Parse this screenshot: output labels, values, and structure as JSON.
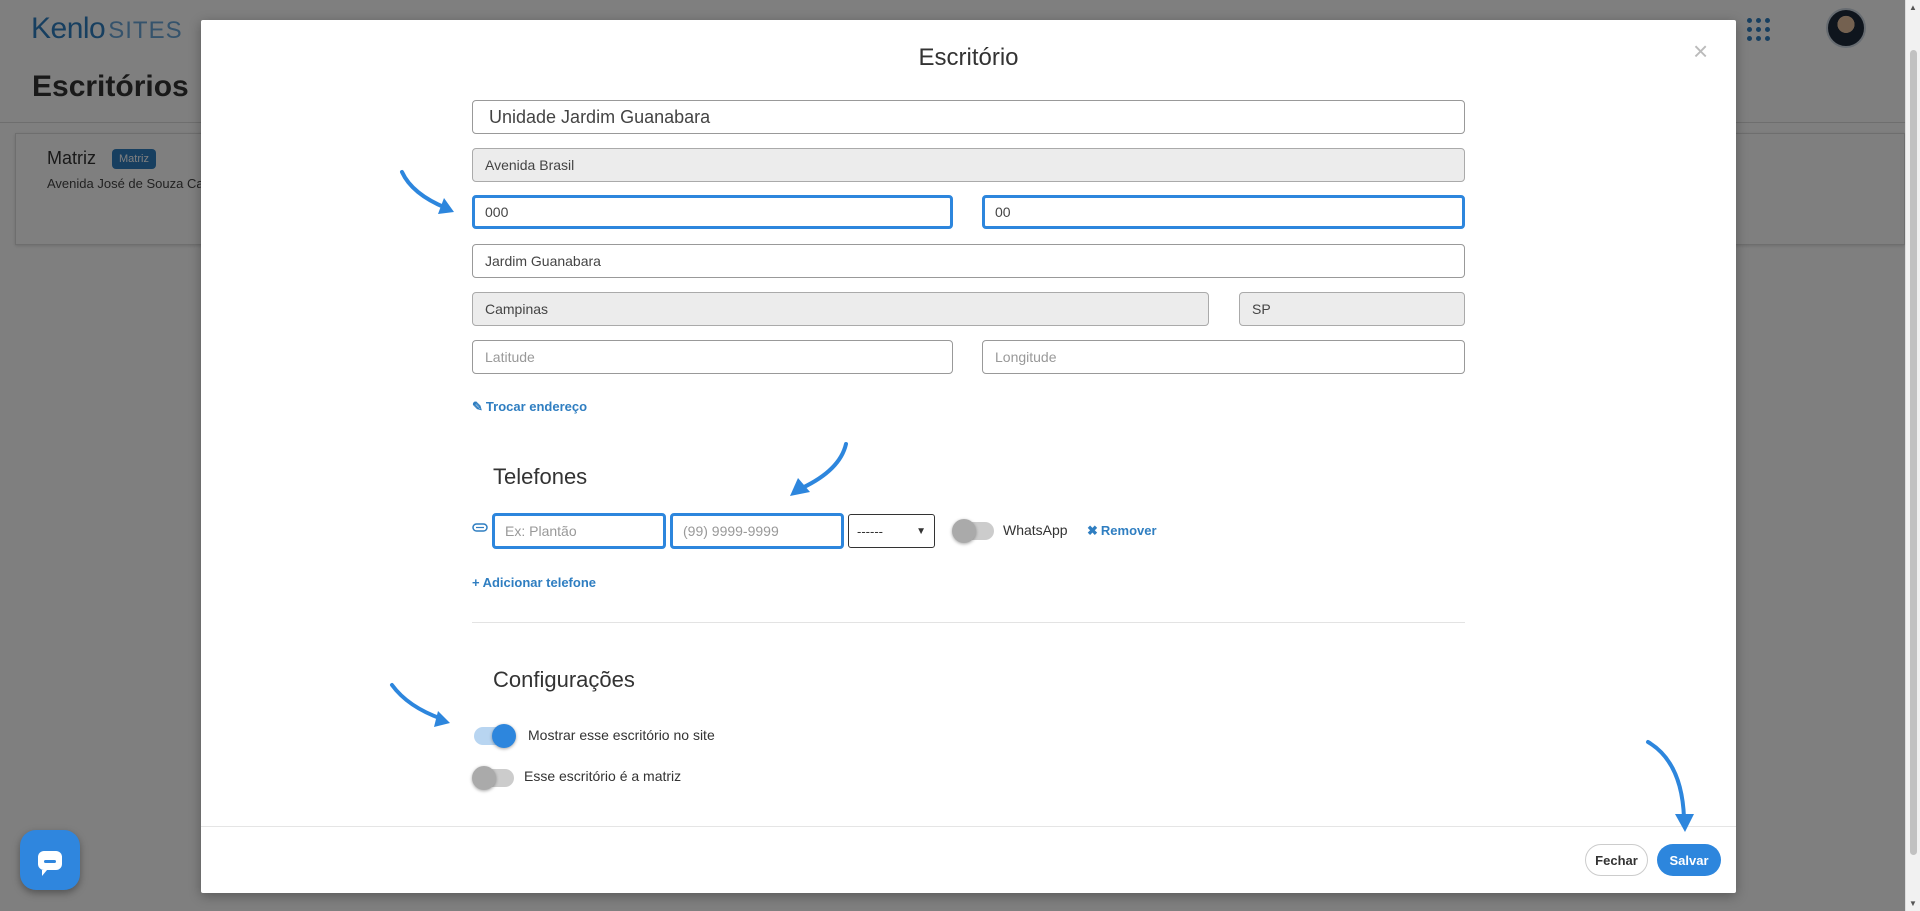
{
  "header": {
    "logo_kenlo": "Kenlo",
    "logo_sites": "SITES",
    "page_title": "Escritórios"
  },
  "background_card": {
    "name": "Matriz",
    "badge": "Matriz",
    "address": "Avenida José de Souza Ca"
  },
  "modal": {
    "title": "Escritório",
    "close_glyph": "×",
    "address_fields": {
      "name": "Unidade Jardim Guanabara",
      "street": "Avenida Brasil",
      "number": "000",
      "complement": "00",
      "neighborhood": "Jardim Guanabara",
      "city": "Campinas",
      "state": "SP",
      "latitude_placeholder": "Latitude",
      "longitude_placeholder": "Longitude"
    },
    "change_address_link": "Trocar endereço",
    "phones": {
      "section_title": "Telefones",
      "label_placeholder": "Ex: Plantão",
      "number_placeholder": "(99) 9999-9999",
      "type_select_value": "------",
      "whatsapp_label": "WhatsApp",
      "whatsapp_enabled": false,
      "remove_link": "Remover",
      "add_link": "Adicionar telefone"
    },
    "settings": {
      "section_title": "Configurações",
      "show_on_site_label": "Mostrar esse escritório no site",
      "show_on_site_enabled": true,
      "is_headquarters_label": "Esse escritório é a matriz",
      "is_headquarters_enabled": false
    },
    "footer": {
      "close_button": "Fechar",
      "save_button": "Salvar"
    }
  },
  "colors": {
    "accent": "#2d86dd",
    "brand": "#2f7ec1",
    "overlay": "rgba(0,0,0,0.5)"
  },
  "icons": [
    "grid-apps-icon",
    "avatar",
    "chat-icon",
    "close-icon",
    "edit-icon",
    "phone-icon",
    "chevron-down-icon",
    "remove-icon",
    "plus-icon",
    "arrow-annotation-icon"
  ]
}
